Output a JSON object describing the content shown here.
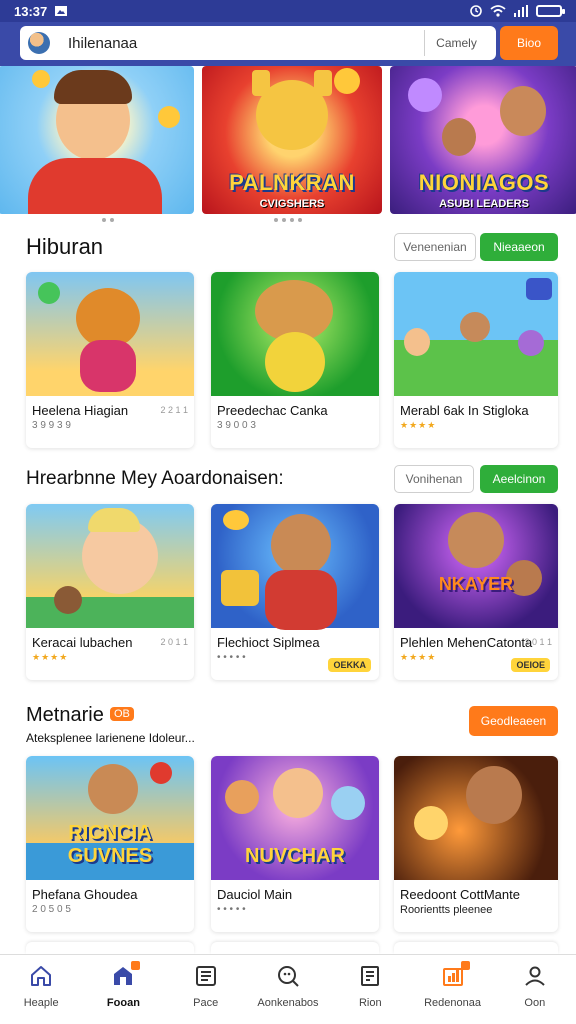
{
  "status_bar": {
    "time": "13:37",
    "icons": [
      "image-icon",
      "alarm-icon",
      "wifi-icon",
      "signal-icon",
      "battery-icon"
    ]
  },
  "header": {
    "search_value": "Ihilenanaa",
    "category_label": "Camely",
    "action_label": "Bioo"
  },
  "banner": {
    "slides": [
      {
        "title": "",
        "subtitle": ""
      },
      {
        "title": "PALNKRAN",
        "subtitle": "CVIGSHERS"
      },
      {
        "title": "NIONIAGOS",
        "subtitle": "ASUBI LEADERS"
      }
    ],
    "page_indicator": {
      "count": 3,
      "active": 1
    }
  },
  "sections": [
    {
      "title": "Hiburan",
      "outline_button": "Venenenian",
      "green_button": "Nieaaeon",
      "cards": [
        {
          "name": "Heelena Hiagian",
          "meta": "3 9 9 3 9",
          "side": "2 2 1 1"
        },
        {
          "name": "Preedechac Canka",
          "meta": "3 9 0 0 3",
          "side": ""
        },
        {
          "name": "Merabl 6ak In Stigloka",
          "meta": "★★★★",
          "side": ""
        }
      ]
    },
    {
      "title": "Hrearbnne Mey Aoardonaisen:",
      "outline_button": "Vonihenan",
      "green_button": "Aeelcinon",
      "cards": [
        {
          "name": "Keracai lubachen",
          "meta": "★★★★",
          "side": "2 0 1 1",
          "tag": ""
        },
        {
          "name": "Flechioct Siplmea",
          "meta": "• • • • •",
          "side": "",
          "tag": "OEKKA"
        },
        {
          "name": "Plehlen MehenCatonta",
          "meta": "★★★★",
          "side": "2 0 1 1",
          "tag": "OEIOE"
        }
      ]
    },
    {
      "title": "Metnarie",
      "badge": "OB",
      "subtitle": "Ateksplenee Iarienene Idoleur...",
      "orange_button": "Geodleaeen",
      "cards": [
        {
          "name": "Phefana Ghoudea",
          "meta": "2 0 5 0 5",
          "art_title": "RICNCIA GUVNES"
        },
        {
          "name": "Dauciol Main",
          "meta": "• • • • •",
          "art_title": "NUVCHAR"
        },
        {
          "name": "Reedoont CottMante",
          "meta": "Roorientts pleenee",
          "art_title": ""
        }
      ]
    }
  ],
  "bottom_nav": [
    {
      "label": "Heaple",
      "icon": "home-icon",
      "active": false
    },
    {
      "label": "Fooan",
      "icon": "store-icon",
      "active": true
    },
    {
      "label": "Pace",
      "icon": "list-icon",
      "active": false
    },
    {
      "label": "Aonkenabos",
      "icon": "chat-search-icon",
      "active": false
    },
    {
      "label": "Rion",
      "icon": "document-icon",
      "active": false
    },
    {
      "label": "Redenonaa",
      "icon": "chart-icon",
      "active": false
    },
    {
      "label": "Oon",
      "icon": "profile-icon",
      "active": false
    }
  ],
  "colors": {
    "header_blue": "#3a4aa8",
    "accent_orange": "#ff7a1a",
    "accent_green": "#2fae3a"
  }
}
